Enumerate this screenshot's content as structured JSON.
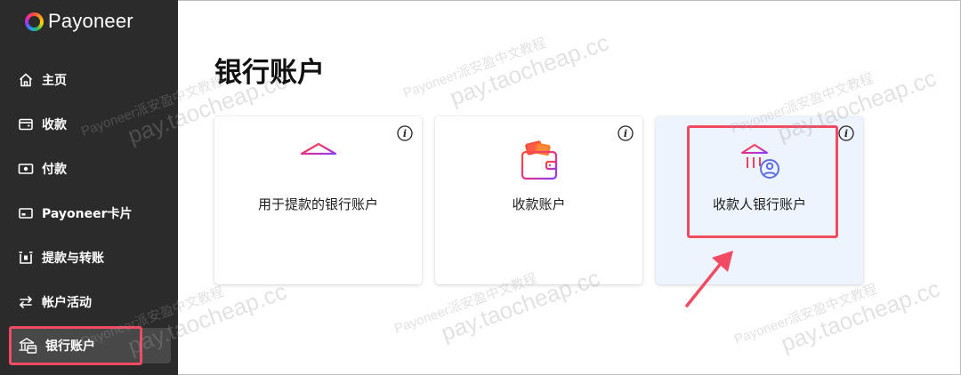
{
  "brand": {
    "name": "Payoneer"
  },
  "sidebar": {
    "items": [
      {
        "label": "主页",
        "icon": "home-icon"
      },
      {
        "label": "收款",
        "icon": "wallet-icon"
      },
      {
        "label": "付款",
        "icon": "cash-icon"
      },
      {
        "label": "Payoneer卡片",
        "icon": "card-icon"
      },
      {
        "label": "提款与转账",
        "icon": "withdraw-icon"
      },
      {
        "label": "帐户活动",
        "icon": "transfer-arrows-icon"
      },
      {
        "label": "银行账户",
        "icon": "bank-account-icon",
        "active": true
      }
    ]
  },
  "main": {
    "title": "银行账户",
    "cards": [
      {
        "label": "用于提款的银行账户",
        "icon": "bank-icon"
      },
      {
        "label": "收款账户",
        "icon": "wallet-cards-icon"
      },
      {
        "label": "收款人银行账户",
        "icon": "bank-person-icon",
        "highlighted": true
      }
    ],
    "info_glyph": "i"
  },
  "watermark": {
    "line1": "Payoneer派安盈中文教程",
    "line2": "pay.taocheap.cc"
  },
  "colors": {
    "sidebar_bg": "#2b2b2b",
    "active_bg": "#484848",
    "annotation_red": "#f04b63",
    "icon_gradient_start": "#ff4f38",
    "icon_gradient_end": "#8a3cff",
    "highlight_card_bg": "#eef4fd"
  }
}
